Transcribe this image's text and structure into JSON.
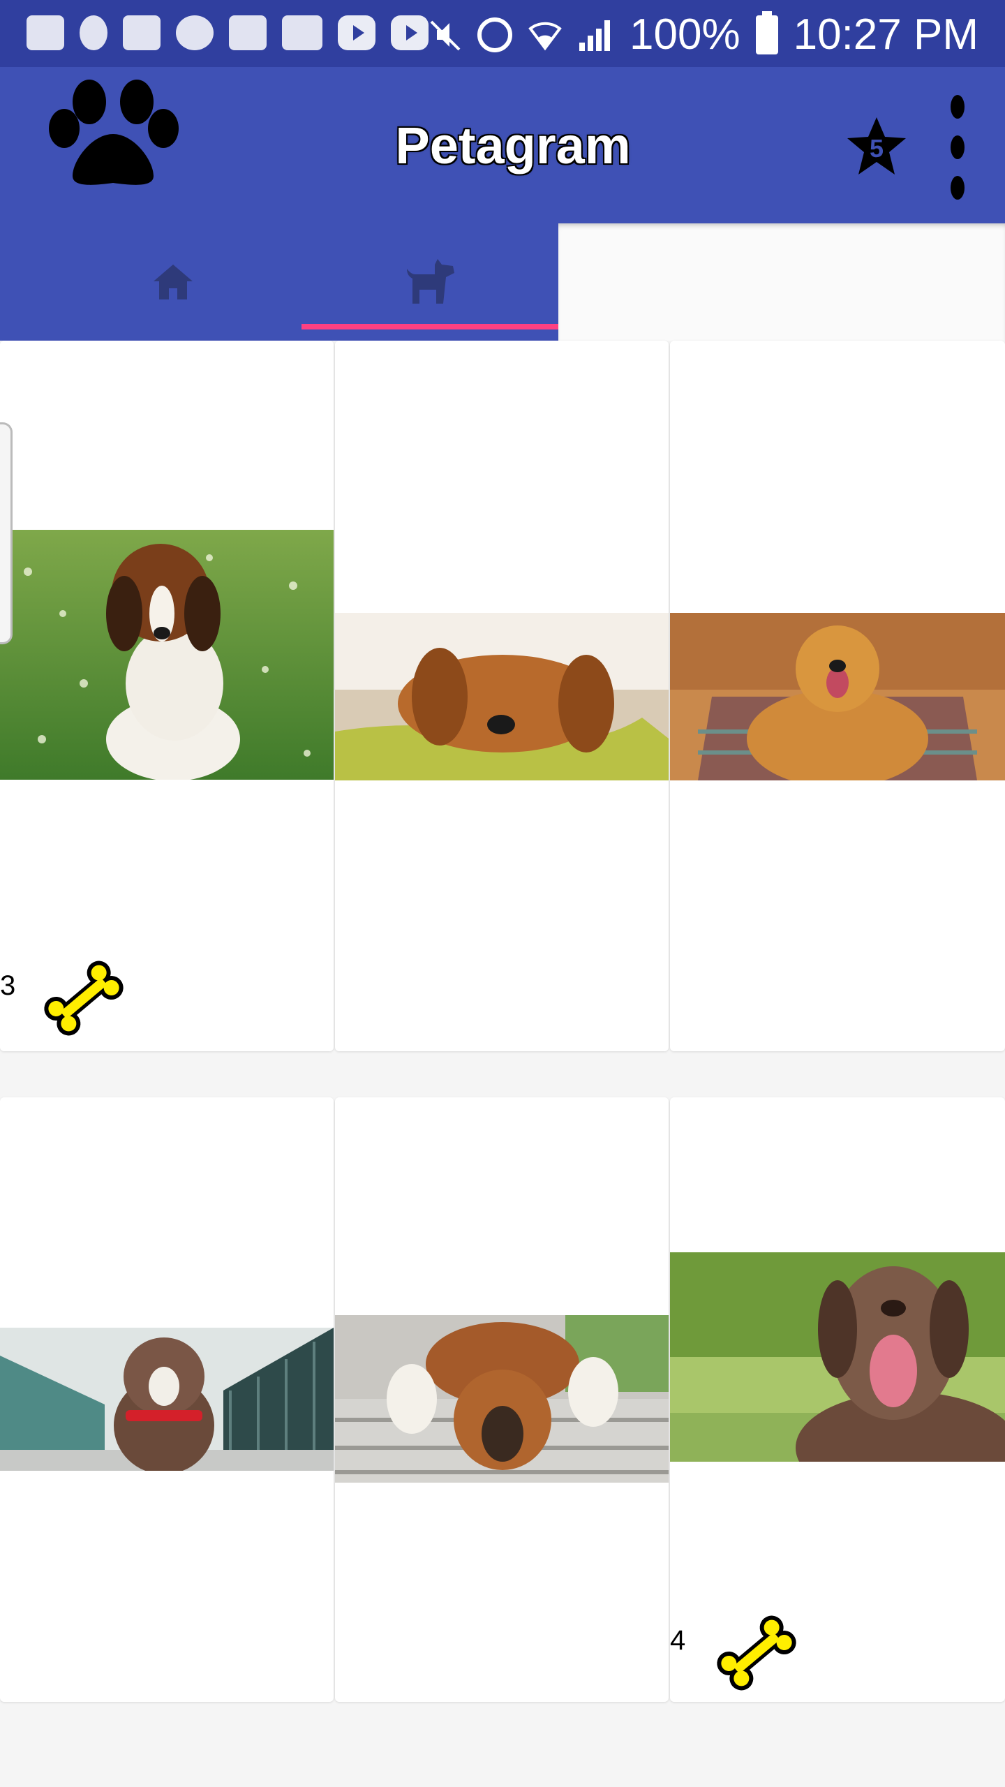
{
  "status_bar": {
    "battery": "100%",
    "time": "10:27 PM",
    "left_icons": [
      "messages-icon",
      "usb-icon",
      "calendar-icon",
      "whatsapp-icon",
      "gallery-icon",
      "cast-icon",
      "youtube-icon",
      "youtube-icon"
    ],
    "right_icons": [
      "mute-icon",
      "alarm-icon",
      "wifi-icon",
      "signal-icon",
      "battery-icon"
    ]
  },
  "app_bar": {
    "title": "Petagram",
    "logo": "paw-icon",
    "favorites_count": "5",
    "colors": {
      "primary": "#3f51b5",
      "primary_dark": "#303f9f",
      "accent": "#ff4081"
    }
  },
  "tabs": [
    {
      "name": "home",
      "icon": "home-icon",
      "selected": false
    },
    {
      "name": "profile",
      "icon": "dog-icon",
      "selected": true
    }
  ],
  "grid": [
    {
      "photo": "beagle puppy in grass",
      "rating": "3",
      "bone_icon": "bone-icon"
    },
    {
      "photo": "golden puppy resting on blanket",
      "rating": "",
      "bone_icon": ""
    },
    {
      "photo": "golden retriever on rug",
      "rating": "",
      "bone_icon": ""
    },
    {
      "photo": "pit bull with red collar on bridge",
      "rating": "",
      "bone_icon": ""
    },
    {
      "photo": "boxer behind fence",
      "rating": "",
      "bone_icon": ""
    },
    {
      "photo": "chocolate labrador smiling",
      "rating": "4",
      "bone_icon": "bone-icon"
    }
  ]
}
